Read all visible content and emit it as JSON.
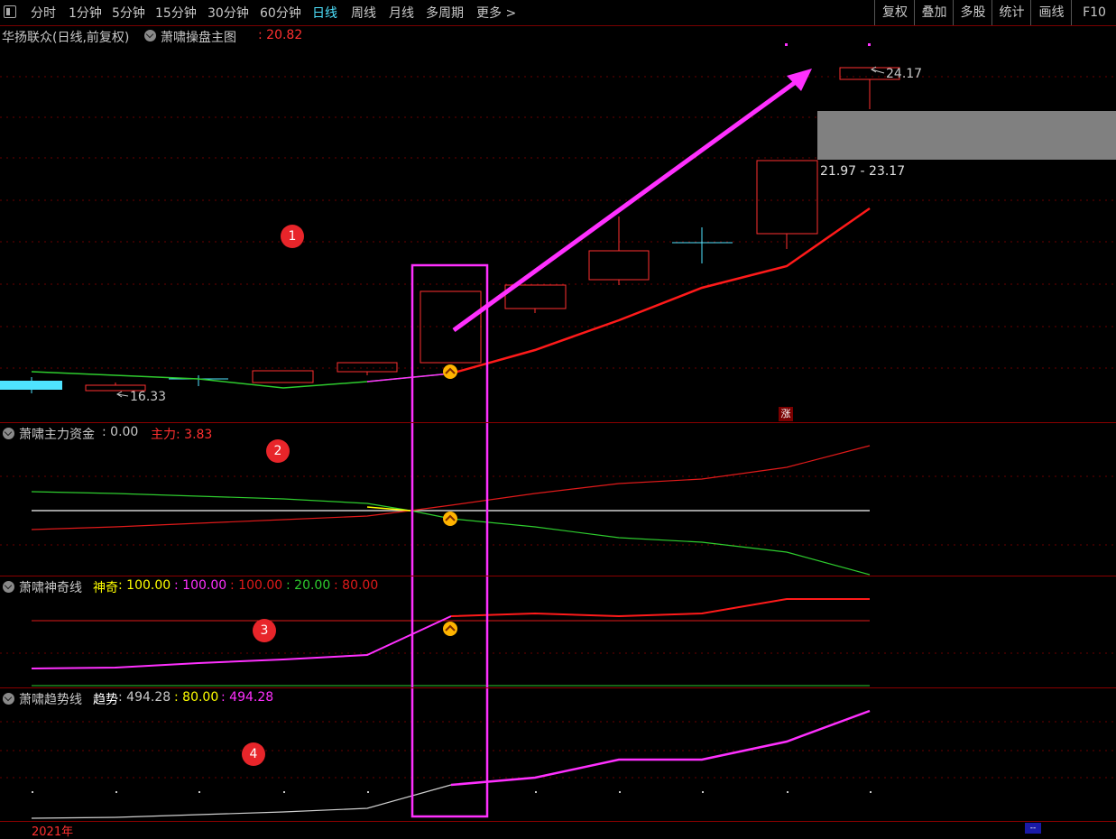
{
  "toolbar": {
    "tabs": [
      "分时",
      "1分钟",
      "5分钟",
      "15分钟",
      "30分钟",
      "60分钟",
      "日线",
      "周线",
      "月线",
      "多周期",
      "更多 >"
    ],
    "active_tab": "日线",
    "right_buttons": [
      "复权",
      "叠加",
      "多股",
      "统计",
      "画线",
      "F10"
    ]
  },
  "main_panel": {
    "title": "华扬联众(日线,前复权)",
    "indicator_name": "萧啸操盘主图",
    "indicator_value": ": 20.82",
    "high_label": "24.17",
    "low_label": "16.33",
    "range_label": "21.97 - 23.17",
    "zhang_label": "涨"
  },
  "panel2": {
    "name": "萧啸主力资金",
    "value": ": 0.00",
    "extra_label": "主力: 3.83"
  },
  "panel3": {
    "name": "萧啸神奇线",
    "label": "神奇",
    "values": [
      ": 100.00",
      ": 100.00",
      ": 100.00",
      ": 20.00",
      ": 80.00"
    ]
  },
  "panel4": {
    "name": "萧啸趋势线",
    "label": "趋势",
    "values": [
      ": 494.28",
      ": 80.00",
      ": 494.28"
    ]
  },
  "badges": [
    "1",
    "2",
    "3",
    "4"
  ],
  "footer": {
    "year": "2021年",
    "mini": "--"
  },
  "colors": {
    "accent": "#4fe3ff",
    "up": "#ff3030",
    "down": "#2ecc2e",
    "magenta": "#ff30ff",
    "yellow": "#ffff00",
    "grid": "#6a0000"
  }
}
